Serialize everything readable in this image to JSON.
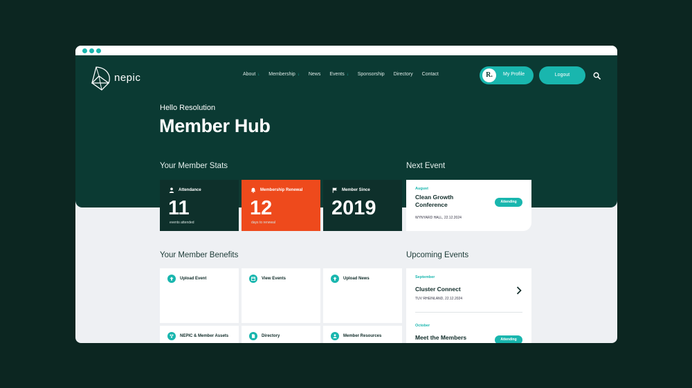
{
  "colors": {
    "page_bg": "#0c2621",
    "hero": "#0b3a33",
    "accent": "#19b6ae",
    "renewal": "#ee4a1c",
    "card_dark": "#0e302b",
    "content_bg": "#eef0f3"
  },
  "brand": {
    "name": "nepic"
  },
  "nav": {
    "items": [
      {
        "label": "About",
        "dropdown": true
      },
      {
        "label": "Membership",
        "dropdown": true
      },
      {
        "label": "News",
        "dropdown": false
      },
      {
        "label": "Events",
        "dropdown": true
      },
      {
        "label": "Sponsorship",
        "dropdown": false
      },
      {
        "label": "Directory",
        "dropdown": false
      },
      {
        "label": "Contact",
        "dropdown": false
      }
    ],
    "chevron": "↓"
  },
  "header": {
    "avatar_letter": "R.",
    "profile_label": "My Profile",
    "logout_label": "Logout",
    "search_icon": "search-icon"
  },
  "hero": {
    "greeting": "Hello Resolution",
    "title": "Member Hub"
  },
  "stats": {
    "title": "Your Member Stats",
    "cards": [
      {
        "label": "Attendance",
        "value": "11",
        "caption": "events attended",
        "icon": "person-icon"
      },
      {
        "label": "Membership Renewal",
        "value": "12",
        "caption": "days to renewal",
        "icon": "bell-icon"
      },
      {
        "label": "Member Since",
        "value": "2019",
        "caption": "",
        "icon": "flag-icon"
      }
    ]
  },
  "next_event": {
    "title": "Next Event",
    "month": "August",
    "name": "Clean Growth Conference",
    "location_date": "WYNYARD HALL, 22.12.2024",
    "badge": "Attending"
  },
  "benefits": {
    "title": "Your Member Benefits",
    "items": [
      {
        "label": "Upload Event",
        "icon": "upload-icon"
      },
      {
        "label": "View Events",
        "icon": "calendar-icon"
      },
      {
        "label": "Upload News",
        "icon": "upload-icon"
      },
      {
        "label": "NEPIC & Member Assets",
        "icon": "assets-icon"
      },
      {
        "label": "Directory",
        "icon": "document-icon"
      },
      {
        "label": "Member Resources",
        "icon": "people-icon"
      }
    ]
  },
  "upcoming": {
    "title": "Upcoming Events",
    "events": [
      {
        "month": "September",
        "name": "Cluster Connect",
        "location_date": "TUV RHEINLAND, 22.12.2024"
      },
      {
        "month": "October",
        "name": "Meet the Members",
        "badge": "Attending"
      }
    ]
  }
}
